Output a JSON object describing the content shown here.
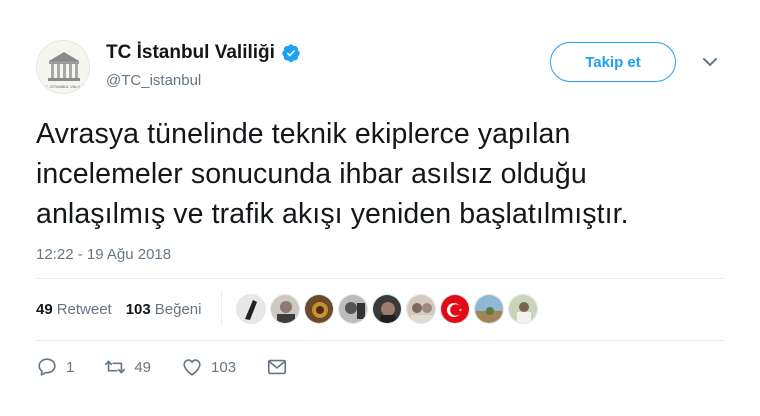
{
  "account": {
    "name": "TC İstanbul Valiliği",
    "handle": "@TC_istanbul",
    "avatar_caption": "T.C. İSTANBUL VALİLİĞİ"
  },
  "follow_label": "Takip et",
  "tweet": {
    "lines": [
      "Avrasya tünelinde teknik ekiplerce yapılan",
      "incelemeler sonucunda ihbar asılsız olduğu",
      "anlaşılmış ve trafik akışı yeniden başlatılmıştır."
    ],
    "timestamp": "12:22 - 19 Ağu 2018"
  },
  "stats": {
    "retweets_count": "49",
    "retweets_label": "Retweet",
    "likes_count": "103",
    "likes_label": "Beğeni"
  },
  "liker_avatars": [
    "avatar-1",
    "avatar-2",
    "avatar-3",
    "avatar-4",
    "avatar-5",
    "avatar-6",
    "turkey-flag-avatar",
    "avatar-8",
    "avatar-9"
  ],
  "actions": {
    "reply_count": "1",
    "retweet_count": "49",
    "like_count": "103"
  },
  "colors": {
    "accent": "#1da1f2",
    "muted": "#657786",
    "text": "#14171a",
    "flag_red": "#e30a17"
  }
}
